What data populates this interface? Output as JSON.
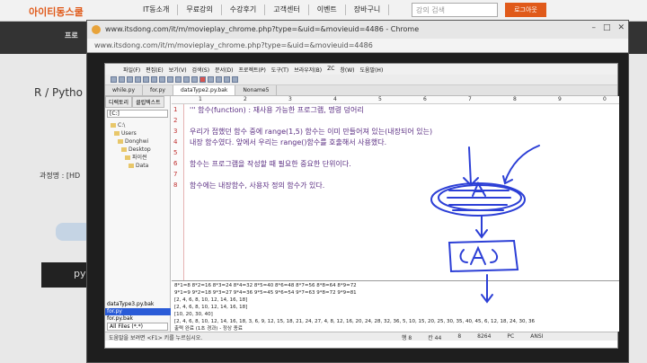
{
  "site": {
    "logo": "아이티동스쿨",
    "nav": [
      "IT동소개",
      "무료강의",
      "수강후기",
      "고객센터",
      "이벤트",
      "장바구니"
    ],
    "search_placeholder": "강의 검색",
    "login": "로그아웃",
    "band_label": "프로",
    "heading": "R / Pytho",
    "course_label": "과정명 : [HD",
    "dark_button": "py"
  },
  "popup": {
    "title": "www.itsdong.com/it/m/movieplay_chrome.php?type=&uid=&movieuid=4486 - Chrome",
    "address": "www.itsdong.com/it/m/movieplay_chrome.php?type=&uid=&movieuid=4486"
  },
  "editor": {
    "menu": [
      "파일(F)",
      "편집(E)",
      "보기(V)",
      "검색(S)",
      "문서(D)",
      "프로젝트(P)",
      "도구(T)",
      "브라우저(B)",
      "ZC",
      "창(W)",
      "도움말(H)"
    ],
    "tabs": [
      "while.py",
      "for.py",
      "dataType2.py.bak",
      "Noname5"
    ],
    "active_tab": 2,
    "sidebar_tabs": [
      "디렉토리",
      "클립텍스트"
    ],
    "drive": "[C:]",
    "tree": [
      "C:\\",
      "Users",
      "Donghwi",
      "Desktop",
      "파이썬",
      "Data"
    ],
    "files": [
      "dataType3.py.bak",
      "for.py",
      "for.py.bak"
    ],
    "selected_file": 1,
    "filter": "All Files (*.*)",
    "ruler": [
      "1",
      "2",
      "3",
      "4",
      "5",
      "6",
      "7",
      "8",
      "9",
      "0"
    ],
    "code_lines": [
      {
        "num": "1",
        "text": "''' 함수(function) : 재사용 가능한 프로그램, 명령 덩어리"
      },
      {
        "num": "2",
        "text": ""
      },
      {
        "num": "3",
        "text": "    우리가 접했던 함수 중에 range(1,5) 함수는 이미 만들어져 있는(내장되어 있는)"
      },
      {
        "num": "4",
        "text": "    내장 함수였다. 앞에서 우리는 range()함수를 호출해서 사용했다."
      },
      {
        "num": "5",
        "text": ""
      },
      {
        "num": "6",
        "text": "    함수는 프로그램을 작성할 때 필요한 중요한 단위이다."
      },
      {
        "num": "7",
        "text": ""
      },
      {
        "num": "8",
        "text": "    함수에는 내장함수, 사용자 정의 함수가 있다."
      }
    ],
    "output_lines": [
      "8*1=8  8*2=16  8*3=24  8*4=32  8*5=40  8*6=48  8*7=56  8*8=64  8*9=72",
      "9*1=9  9*2=18  9*3=27  9*4=36  9*5=45  9*6=54  9*7=63  9*8=72  9*9=81",
      "[2, 4, 6, 8, 10, 12, 14, 16, 18]",
      "[2, 4, 6, 8, 10, 12, 14, 16, 18]",
      "[10, 20, 30, 40]",
      "[2, 4, 6, 8, 10, 12, 14, 16, 18, 3, 6, 9, 12, 15, 18, 21, 24, 27, 4, 8, 12, 16, 20, 24, 28, 32, 36, 5, 10, 15, 20, 25, 30, 35, 40, 45, 6, 12, 18, 24, 30, 36",
      "",
      "출력 완료 (1초 경과) - 정상 종료"
    ],
    "status_left": "도움말을 보려면 <F1> 키를 누르십시오.",
    "status_right": [
      "행 8",
      "칸 44",
      "8",
      "8264",
      "PC",
      "ANSI"
    ]
  }
}
